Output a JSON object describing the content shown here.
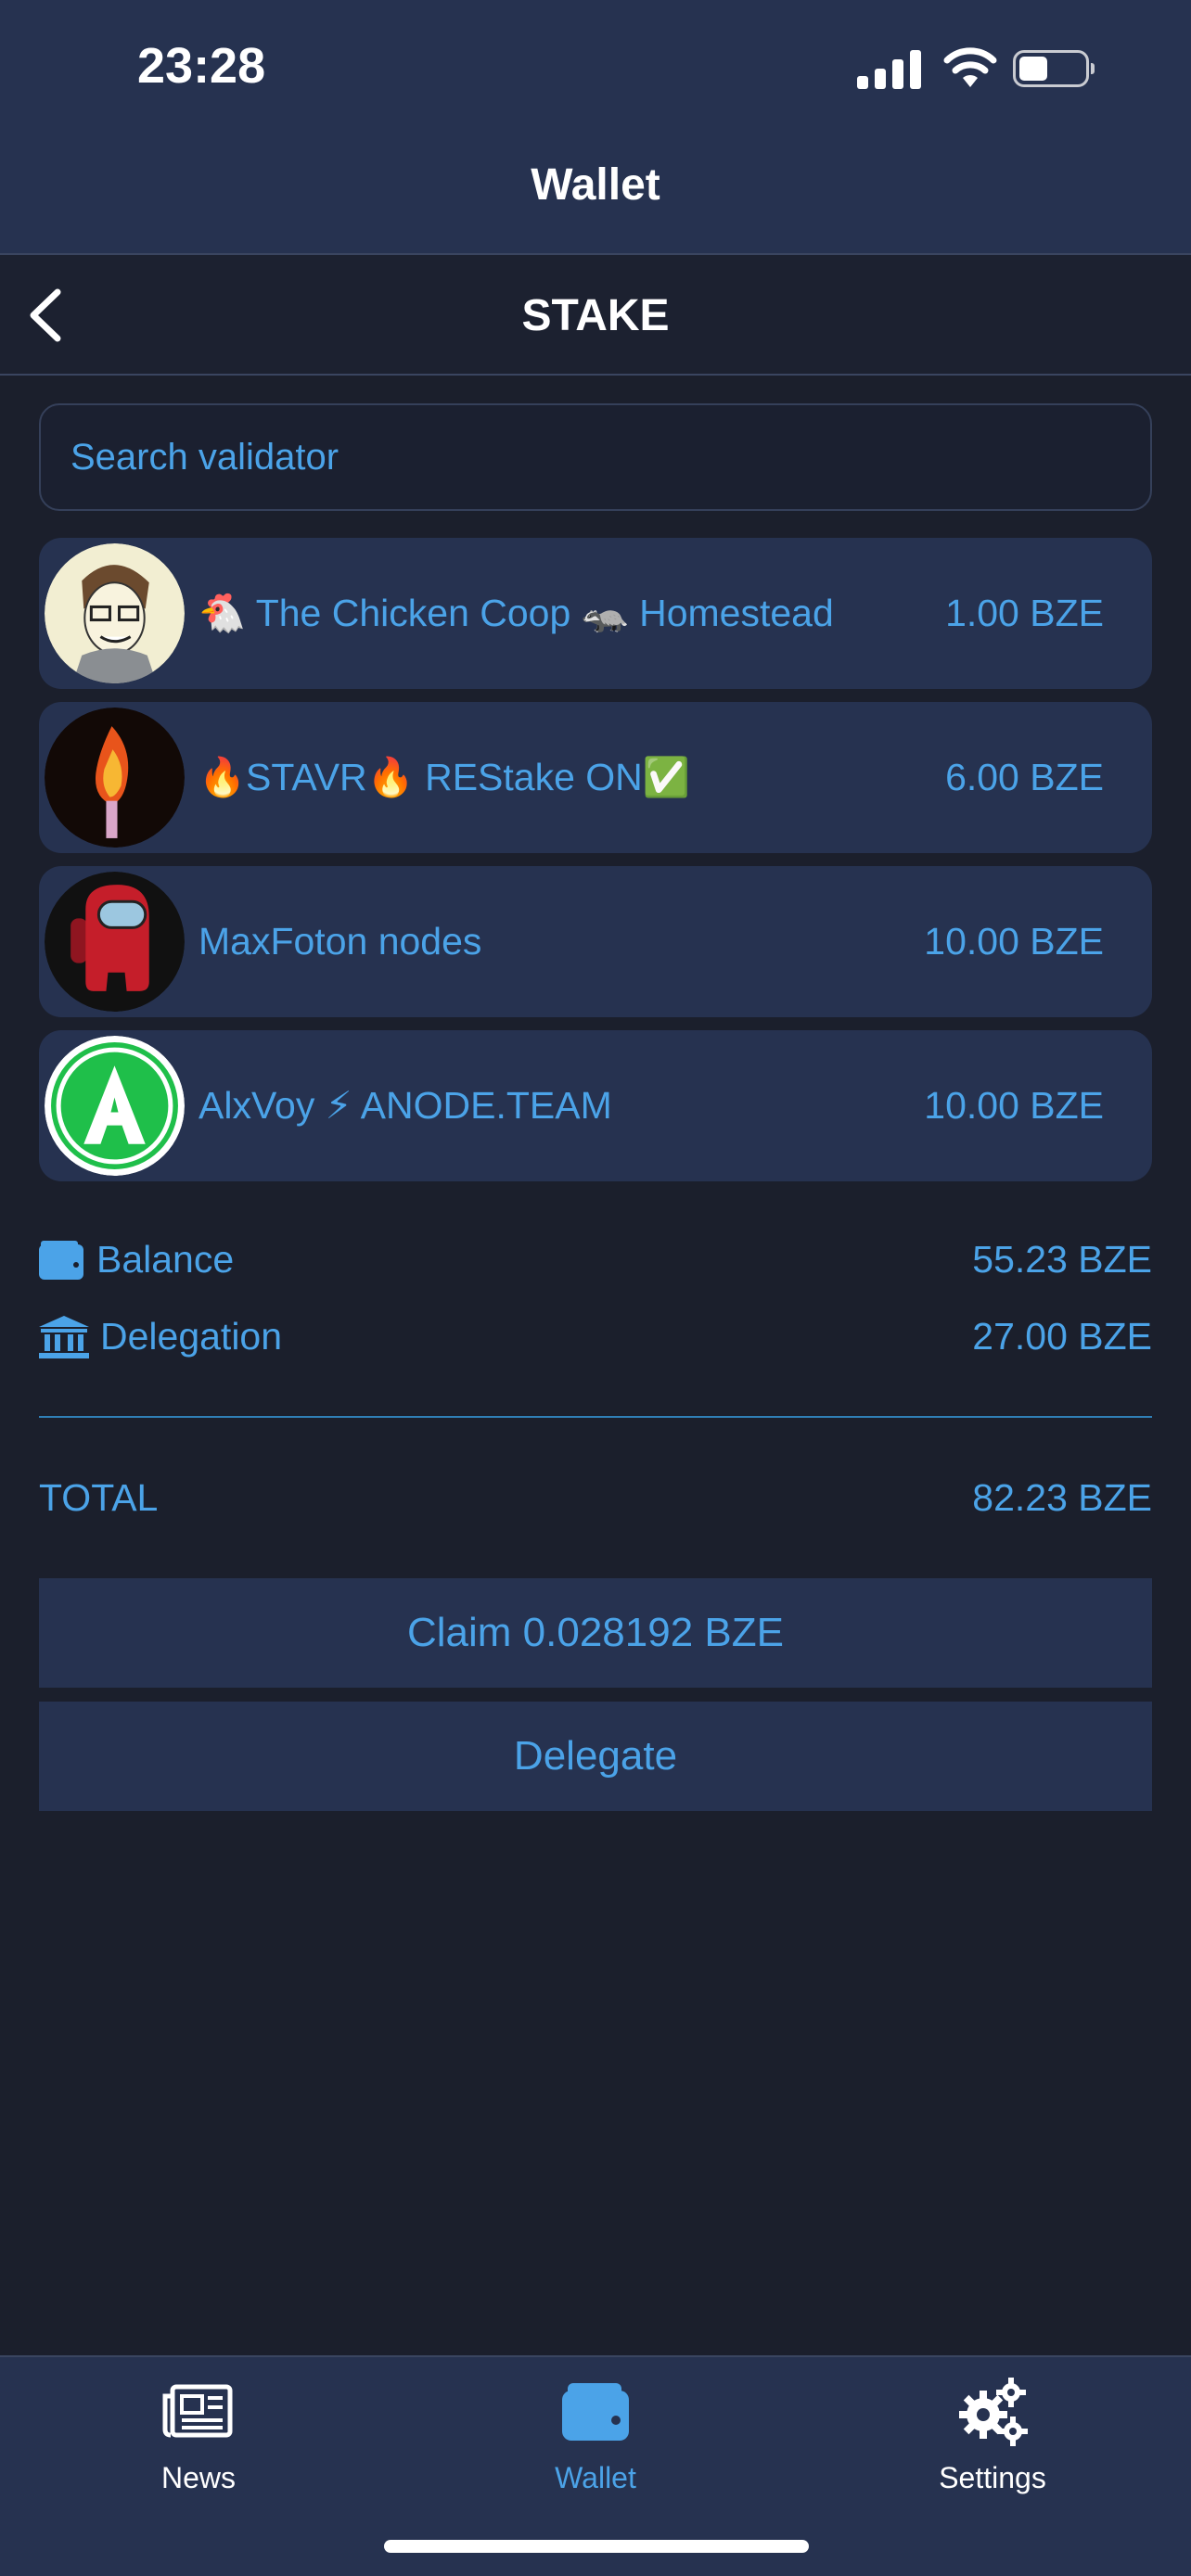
{
  "status_bar": {
    "time": "23:28"
  },
  "header": {
    "title": "Wallet"
  },
  "subheader": {
    "title": "STAKE"
  },
  "search": {
    "placeholder": "Search validator",
    "value": ""
  },
  "validators": [
    {
      "name": "🐔 The Chicken Coop 🦡 Homestead",
      "amount": "1.00 BZE",
      "avatar": "cartoon-face"
    },
    {
      "name": "🔥STAVR🔥 REStake ON✅",
      "amount": "6.00 BZE",
      "avatar": "torch"
    },
    {
      "name": "MaxFoton nodes",
      "amount": "10.00 BZE",
      "avatar": "crewmate"
    },
    {
      "name": "AlxVoy ⚡ ANODE.TEAM",
      "amount": "10.00 BZE",
      "avatar": "green-a-logo"
    }
  ],
  "summary": {
    "balance_label": "Balance",
    "balance_value": "55.23 BZE",
    "delegation_label": "Delegation",
    "delegation_value": "27.00 BZE",
    "total_label": "TOTAL",
    "total_value": "82.23 BZE"
  },
  "actions": {
    "claim_label": "Claim 0.028192 BZE",
    "delegate_label": "Delegate"
  },
  "tabs": [
    {
      "label": "News",
      "icon": "newspaper-icon",
      "active": false
    },
    {
      "label": "Wallet",
      "icon": "wallet-icon",
      "active": true
    },
    {
      "label": "Settings",
      "icon": "gears-icon",
      "active": false
    }
  ],
  "colors": {
    "accent": "#4ba3e8",
    "background": "#1b1f2c",
    "panel": "#263250"
  }
}
